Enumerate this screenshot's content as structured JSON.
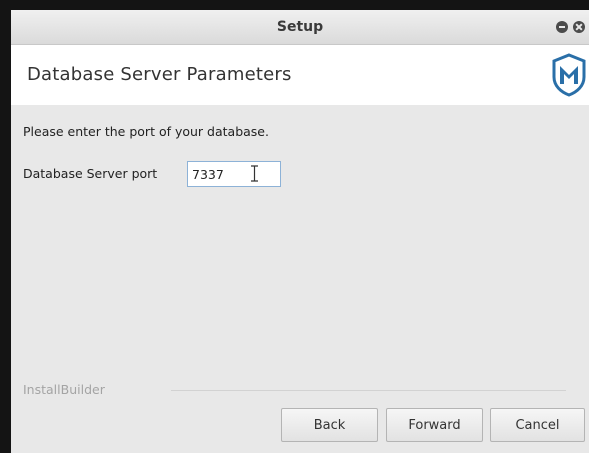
{
  "window": {
    "title": "Setup",
    "controls": [
      "minimize-icon",
      "close-icon"
    ]
  },
  "header": {
    "heading": "Database Server Parameters",
    "logo_icon": "metasploit-shield-logo"
  },
  "content": {
    "instruction": "Please enter the port of your database.",
    "port_label": "Database Server port",
    "port_value": "7337"
  },
  "footer": {
    "brand": "InstallBuilder",
    "back_label": "Back",
    "forward_label": "Forward",
    "cancel_label": "Cancel"
  },
  "colors": {
    "logo": "#2a6fa8",
    "input_border": "#8db2d7",
    "background": "#e8e8e8"
  }
}
